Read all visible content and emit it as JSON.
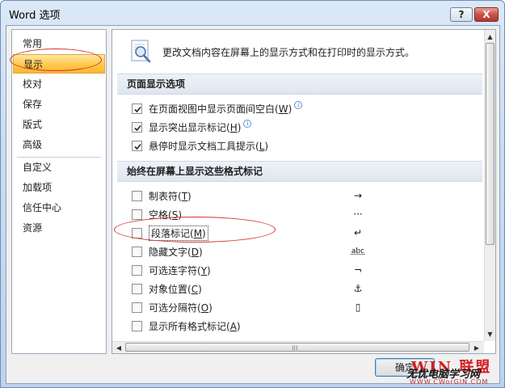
{
  "window": {
    "title": "Word 选项",
    "help_label": "?",
    "close_label": "X"
  },
  "nav": {
    "items": [
      {
        "label": "常用"
      },
      {
        "label": "显示"
      },
      {
        "label": "校对"
      },
      {
        "label": "保存"
      },
      {
        "label": "版式"
      },
      {
        "label": "高级"
      },
      {
        "label": "自定义"
      },
      {
        "label": "加载项"
      },
      {
        "label": "信任中心"
      },
      {
        "label": "资源"
      }
    ],
    "selected": "显示"
  },
  "header": {
    "description": "更改文档内容在屏幕上的显示方式和在打印时的显示方式。"
  },
  "page_display": {
    "title": "页面显示选项",
    "options": [
      {
        "label": "在页面视图中显示页面间空白(",
        "key": "W",
        "suffix": ")",
        "checked": true,
        "info": true
      },
      {
        "label": "显示突出显示标记(",
        "key": "H",
        "suffix": ")",
        "checked": true,
        "info": true
      },
      {
        "label": "悬停时显示文档工具提示(",
        "key": "L",
        "suffix": ")",
        "checked": true,
        "info": false
      }
    ]
  },
  "format_marks": {
    "title": "始终在屏幕上显示这些格式标记",
    "options": [
      {
        "label": "制表符(",
        "key": "T",
        "suffix": ")",
        "checked": false,
        "symbol": "→"
      },
      {
        "label": "空格(",
        "key": "S",
        "suffix": ")",
        "checked": false,
        "symbol": "···"
      },
      {
        "label": "段落标记(",
        "key": "M",
        "suffix": ")",
        "checked": false,
        "symbol": "↵"
      },
      {
        "label": "隐藏文字(",
        "key": "D",
        "suffix": ")",
        "checked": false,
        "symbol": "abc"
      },
      {
        "label": "可选连字符(",
        "key": "Y",
        "suffix": ")",
        "checked": false,
        "symbol": "¬"
      },
      {
        "label": "对象位置(",
        "key": "C",
        "suffix": ")",
        "checked": false,
        "symbol": "⚓"
      },
      {
        "label": "可选分隔符(",
        "key": "O",
        "suffix": ")",
        "checked": false,
        "symbol": "▯"
      },
      {
        "label": "显示所有格式标记(",
        "key": "A",
        "suffix": ")",
        "checked": false,
        "symbol": ""
      }
    ]
  },
  "footer": {
    "ok_label": "确定"
  },
  "watermark": {
    "logo": "WIN 联盟",
    "text": "无忧电脑学习网",
    "url": "WWW.CWorGIN.COM"
  },
  "colors": {
    "selection": "#ffc84b",
    "annotation": "#d3342f",
    "window_frame": "#c9dcf1"
  }
}
